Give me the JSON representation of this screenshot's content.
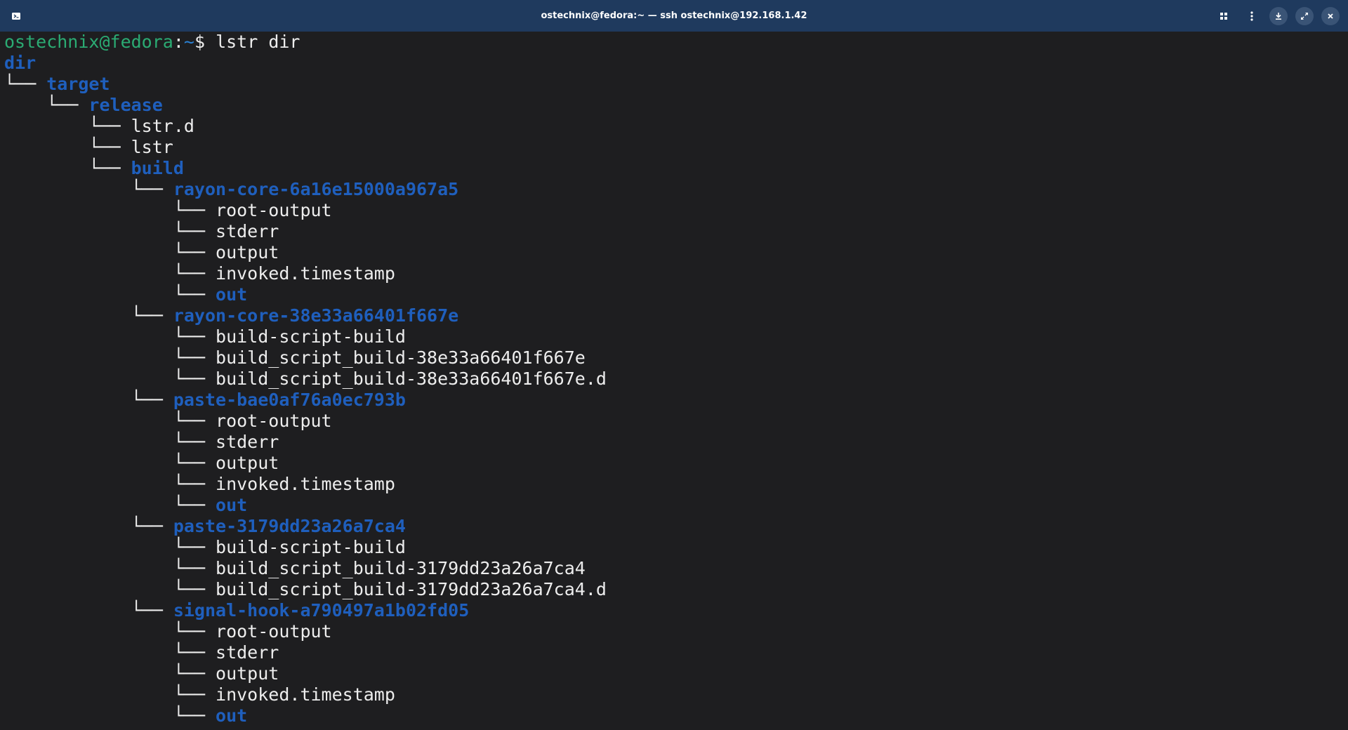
{
  "window": {
    "title": "ostechnix@fedora:~ — ssh ostechnix@192.168.1.42",
    "icons": [
      "terminal-new-tab-icon",
      "grid-icon",
      "kebab-menu-icon",
      "download-icon",
      "restore-icon",
      "close-icon"
    ]
  },
  "colors": {
    "titlebar": "#1f3a5e",
    "background": "#1e1e20",
    "prompt_user": "#2bab73",
    "prompt_path": "#2a82d6",
    "directory": "#1f5fbd",
    "text": "#ededed"
  },
  "prompt": {
    "user_host": "ostechnix@fedora",
    "separator": ":",
    "path": "~",
    "symbol": "$",
    "command": " lstr dir"
  },
  "tree": [
    {
      "branch": "",
      "name": "dir",
      "type": "dir"
    },
    {
      "branch": "└── ",
      "name": "target",
      "type": "dir"
    },
    {
      "branch": "    └── ",
      "name": "release",
      "type": "dir"
    },
    {
      "branch": "        └── ",
      "name": "lstr.d",
      "type": "file"
    },
    {
      "branch": "        └── ",
      "name": "lstr",
      "type": "file"
    },
    {
      "branch": "        └── ",
      "name": "build",
      "type": "dir"
    },
    {
      "branch": "            └── ",
      "name": "rayon-core-6a16e15000a967a5",
      "type": "dir"
    },
    {
      "branch": "                └── ",
      "name": "root-output",
      "type": "file"
    },
    {
      "branch": "                └── ",
      "name": "stderr",
      "type": "file"
    },
    {
      "branch": "                └── ",
      "name": "output",
      "type": "file"
    },
    {
      "branch": "                └── ",
      "name": "invoked.timestamp",
      "type": "file"
    },
    {
      "branch": "                └── ",
      "name": "out",
      "type": "dir"
    },
    {
      "branch": "            └── ",
      "name": "rayon-core-38e33a66401f667e",
      "type": "dir"
    },
    {
      "branch": "                └── ",
      "name": "build-script-build",
      "type": "file"
    },
    {
      "branch": "                └── ",
      "name": "build_script_build-38e33a66401f667e",
      "type": "file"
    },
    {
      "branch": "                └── ",
      "name": "build_script_build-38e33a66401f667e.d",
      "type": "file"
    },
    {
      "branch": "            └── ",
      "name": "paste-bae0af76a0ec793b",
      "type": "dir"
    },
    {
      "branch": "                └── ",
      "name": "root-output",
      "type": "file"
    },
    {
      "branch": "                └── ",
      "name": "stderr",
      "type": "file"
    },
    {
      "branch": "                └── ",
      "name": "output",
      "type": "file"
    },
    {
      "branch": "                └── ",
      "name": "invoked.timestamp",
      "type": "file"
    },
    {
      "branch": "                └── ",
      "name": "out",
      "type": "dir"
    },
    {
      "branch": "            └── ",
      "name": "paste-3179dd23a26a7ca4",
      "type": "dir"
    },
    {
      "branch": "                └── ",
      "name": "build-script-build",
      "type": "file"
    },
    {
      "branch": "                └── ",
      "name": "build_script_build-3179dd23a26a7ca4",
      "type": "file"
    },
    {
      "branch": "                └── ",
      "name": "build_script_build-3179dd23a26a7ca4.d",
      "type": "file"
    },
    {
      "branch": "            └── ",
      "name": "signal-hook-a790497a1b02fd05",
      "type": "dir"
    },
    {
      "branch": "                └── ",
      "name": "root-output",
      "type": "file"
    },
    {
      "branch": "                └── ",
      "name": "stderr",
      "type": "file"
    },
    {
      "branch": "                └── ",
      "name": "output",
      "type": "file"
    },
    {
      "branch": "                └── ",
      "name": "invoked.timestamp",
      "type": "file"
    },
    {
      "branch": "                └── ",
      "name": "out",
      "type": "dir"
    }
  ]
}
